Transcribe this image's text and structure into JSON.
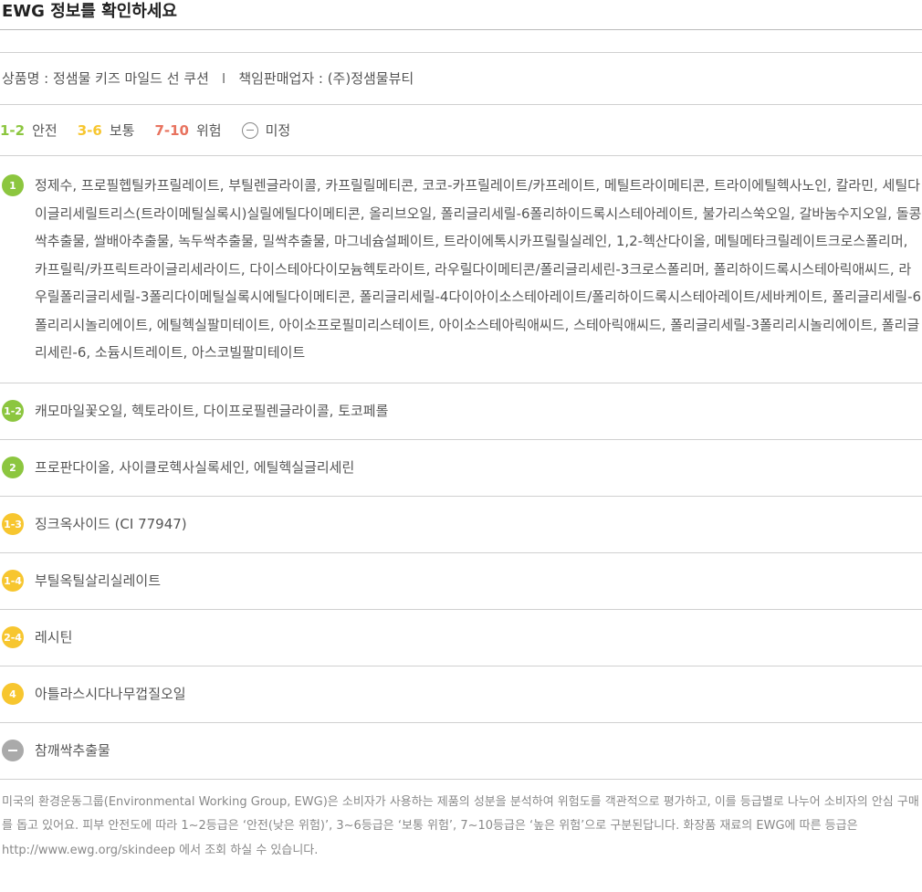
{
  "header": {
    "title": "EWG 정보를 확인하세요"
  },
  "product": {
    "name_label": "상품명 : 정샘물 키즈 마일드 선 쿠션",
    "separator": "I",
    "seller_label": "책임판매업자 : (주)정샘물뷰티"
  },
  "legend": [
    {
      "range": "1-2",
      "label": "안전",
      "color": "#8cc63f"
    },
    {
      "range": "3-6",
      "label": "보통",
      "color": "#f7c62f"
    },
    {
      "range": "7-10",
      "label": "위험",
      "color": "#e8735f"
    },
    {
      "range": "",
      "label": "미정",
      "color": "#888888"
    }
  ],
  "ingredients": [
    {
      "grade": "1",
      "color": "#8cc63f",
      "text": "정제수, 프로필헵틸카프릴레이트, 부틸렌글라이콜, 카프릴릴메티콘, 코코-카프릴레이트/카프레이트, 메틸트라이메티콘, 트라이에틸헥사노인, 칼라민, 세틸다이글리세릴트리스(트라이메틸실록시)실릴에틸다이메티콘, 올리브오일, 폴리글리세릴-6폴리하이드록시스테아레이트, 불가리스쑥오일, 갈바눔수지오일, 돌콩싹추출물, 쌀배아추출물, 녹두싹추출물, 밀싹추출물, 마그네슘설페이트, 트라이에톡시카프릴릴실레인, 1,2-헥산다이올, 메틸메타크릴레이트크로스폴리머, 카프릴릭/카프릭트라이글리세라이드, 다이스테아다이모늄헥토라이트, 라우릴다이메티콘/폴리글리세린-3크로스폴리머, 폴리하이드록시스테아릭애씨드, 라우릴폴리글리세릴-3폴리다이메틸실록시에틸다이메티콘, 폴리글리세릴-4다이아이소스테아레이트/폴리하이드록시스테아레이트/세바케이트, 폴리글리세릴-6폴리리시놀리에이트, 에틸헥실팔미테이트, 아이소프로필미리스테이트, 아이소스테아릭애씨드, 스테아릭애씨드, 폴리글리세릴-3폴리리시놀리에이트, 폴리글리세린-6, 소듐시트레이트, 아스코빌팔미테이트"
    },
    {
      "grade": "1-2",
      "color": "#8cc63f",
      "text": "캐모마일꽃오일, 헥토라이트, 다이프로필렌글라이콜, 토코페롤"
    },
    {
      "grade": "2",
      "color": "#8cc63f",
      "text": "프로판다이올, 사이클로헥사실록세인, 에틸헥실글리세린"
    },
    {
      "grade": "1-3",
      "color": "#f7c62f",
      "text": "징크옥사이드 (CI 77947)"
    },
    {
      "grade": "1-4",
      "color": "#f7c62f",
      "text": "부틸옥틸살리실레이트"
    },
    {
      "grade": "2-4",
      "color": "#f7c62f",
      "text": "레시틴"
    },
    {
      "grade": "4",
      "color": "#f7c62f",
      "text": "아틀라스시다나무껍질오일"
    },
    {
      "grade": "",
      "color": "#aaaaaa",
      "icon": "minus-icon",
      "text": "참깨싹추출물"
    }
  ],
  "footer": {
    "text": "미국의 환경운동그룹(Environmental Working Group, EWG)은 소비자가 사용하는 제품의 성분을 분석하여 위험도를 객관적으로 평가하고, 이를 등급별로 나누어 소비자의 안심 구매를 돕고 있어요. 피부 안전도에 따라 1~2등급은 ‘안전(낮은 위험)’, 3~6등급은 ‘보통 위험’, 7~10등급은 ‘높은 위험’으로 구분된답니다. 화장품 재료의 EWG에 따른 등급은 http://www.ewg.org/skindeep 에서 조회 하실 수 있습니다."
  }
}
